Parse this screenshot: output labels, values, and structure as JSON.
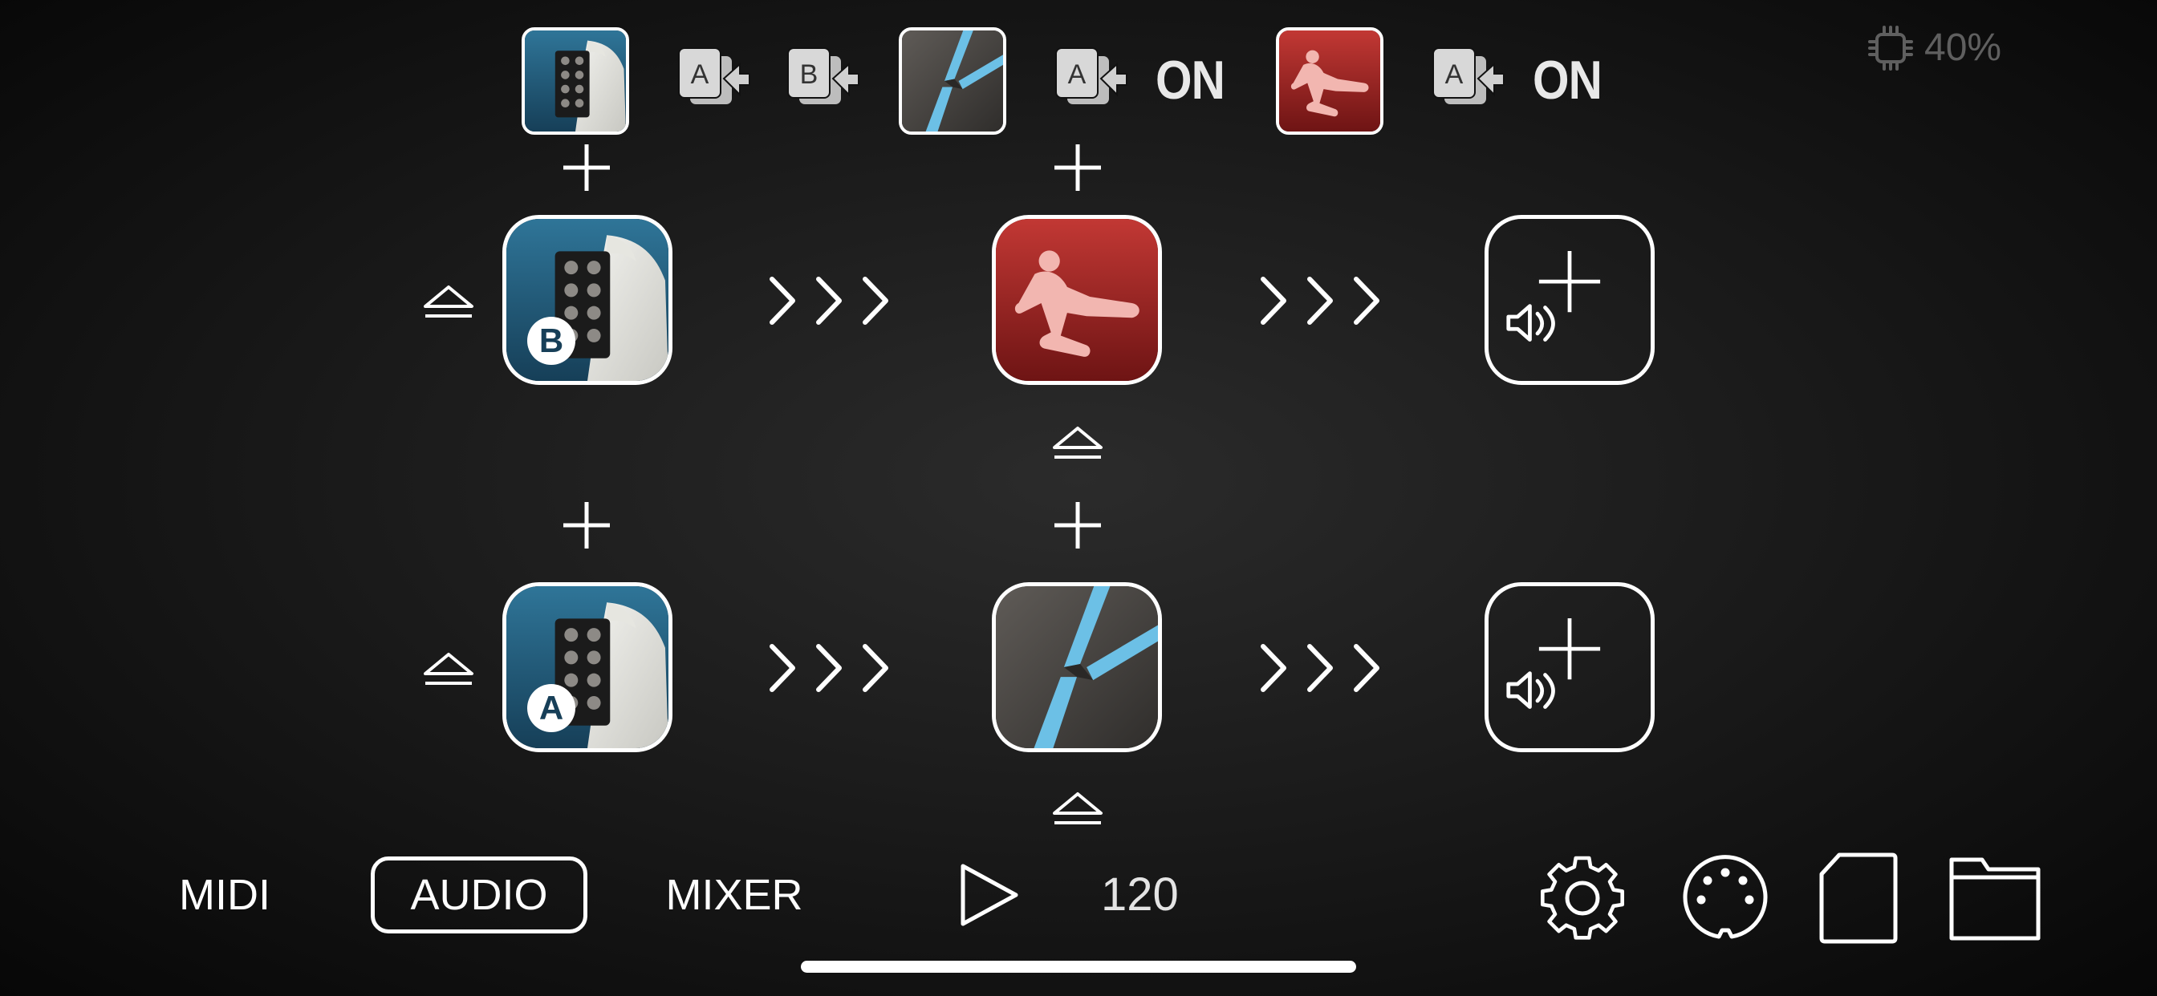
{
  "top_bar": {
    "chain_1": {
      "instrument_icon": "dots-grid-sampler-app-icon",
      "midi_to_a_icon": "midi-route-a-icon",
      "midi_to_b_icon": "midi-route-b-icon"
    },
    "chain_2": {
      "effect_icon": "blue-slash-effect-app-icon",
      "midi_to_a_icon": "midi-route-a-icon",
      "toggle": "ON"
    },
    "chain_3": {
      "effect_icon": "red-kick-effect-app-icon",
      "midi_to_a_icon": "midi-route-a-icon",
      "toggle": "ON"
    },
    "cpu": {
      "icon": "cpu-chip-icon",
      "value": "40%"
    }
  },
  "chains": [
    {
      "badge": "B",
      "source": "dots-grid-sampler-app-icon",
      "effect": "red-kick-effect-app-icon",
      "output": "add-output-speaker-icon"
    },
    {
      "badge": "A",
      "source": "dots-grid-sampler-app-icon",
      "effect": "blue-slash-effect-app-icon",
      "output": "add-output-speaker-icon"
    }
  ],
  "bottom_bar": {
    "tabs": [
      {
        "label": "MIDI",
        "active": false
      },
      {
        "label": "AUDIO",
        "active": true
      },
      {
        "label": "MIXER",
        "active": false
      }
    ],
    "play_icon": "play-icon",
    "tempo": "120",
    "settings_icon": "gear-icon",
    "midi_port_icon": "midi-din-icon",
    "new_session_icon": "document-icon",
    "open_session_icon": "folder-icon"
  },
  "colors": {
    "teal_app": "#1e5a78",
    "red_app": "#a8282a",
    "slash_app": "#4a4744",
    "accent_blue": "#63b9e0"
  }
}
